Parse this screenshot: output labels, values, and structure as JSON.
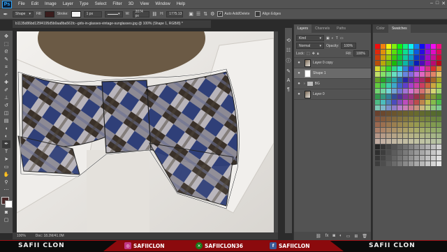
{
  "menubar": {
    "logo": "Ps",
    "items": [
      "File",
      "Edit",
      "Image",
      "Layer",
      "Type",
      "Select",
      "Filter",
      "3D",
      "View",
      "Window",
      "Help"
    ],
    "window_controls": [
      "–",
      "□",
      "✕"
    ]
  },
  "options": {
    "shape_mode": "Shape",
    "fill_label": "Fill:",
    "stroke_label": "Stroke:",
    "stroke_width": "1 px",
    "w_label": "W:",
    "w_value": "2074 px",
    "h_label": "H:",
    "h_value": "1775.13",
    "auto_add_delete": "Auto Add/Delete",
    "align_edges": "Align Edges",
    "fill_color": "#3a1d1d"
  },
  "document": {
    "tab_title": "b1135d86bd125f4195d5b0aa8ba561fc--girls-in-glasses-vintage-sunglasses.jpg @ 100% (Shape 1, RGB/8) *",
    "zoom": "100%",
    "doc_info": "Doc: 18.2M/41.0M"
  },
  "layers_panel": {
    "tabs": [
      "Layers",
      "Channels",
      "Paths"
    ],
    "kind": "Kind",
    "blend_mode": "Normal",
    "opacity_label": "Opacity:",
    "opacity_value": "100%",
    "lock_label": "Lock:",
    "fill_label": "Fill:",
    "fill_value": "100%",
    "layers": [
      {
        "name": "Layer 0 copy",
        "selected": false,
        "type": "pixel"
      },
      {
        "name": "Shape 1",
        "selected": true,
        "type": "shape"
      },
      {
        "name": "BG",
        "selected": false,
        "type": "group"
      },
      {
        "name": "Layer 0",
        "selected": false,
        "type": "pixel"
      }
    ],
    "footer_icons": [
      "link-icon",
      "fx-icon",
      "mask-icon",
      "adjustment-icon",
      "folder-icon",
      "new-layer-icon",
      "trash-icon"
    ]
  },
  "swatches_panel": {
    "tabs": [
      "Color",
      "Swatches"
    ]
  },
  "banner": {
    "left": "SAFII CLON",
    "instagram": "SAFIICLON",
    "xbox": "SAFIICLON36",
    "facebook": "SAFIICLON",
    "right": "SAFII CLON"
  }
}
